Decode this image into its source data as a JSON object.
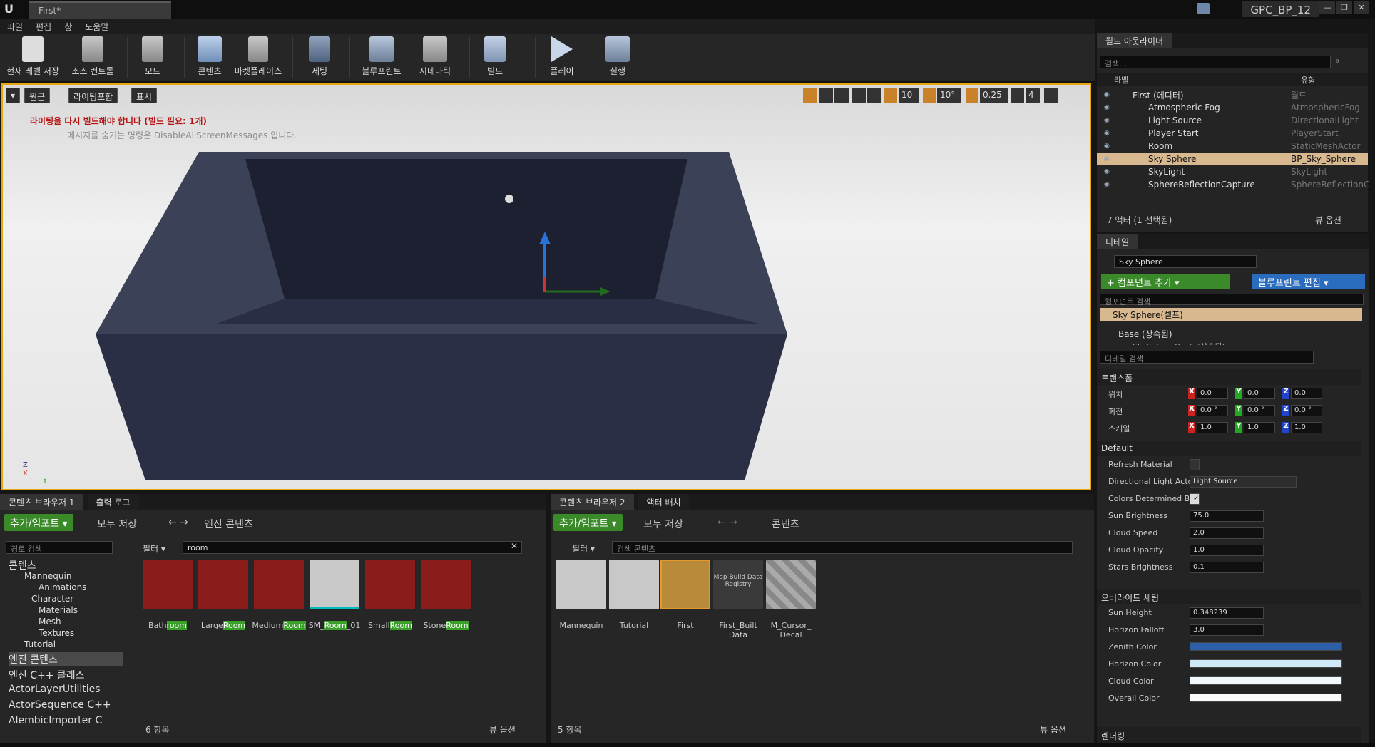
{
  "window": {
    "tab_title": "First*",
    "project": "GPC_BP_12"
  },
  "menu": [
    "파일",
    "편집",
    "창",
    "도움말"
  ],
  "toolbar": [
    {
      "label": "현재 레벨 저장",
      "icon": "save-icon"
    },
    {
      "label": "소스 컨트롤",
      "icon": "source-control-icon"
    },
    {
      "label": "모드",
      "icon": "modes-icon"
    },
    {
      "label": "콘텐츠",
      "icon": "content-icon"
    },
    {
      "label": "마켓플레이스",
      "icon": "marketplace-icon"
    },
    {
      "label": "세팅",
      "icon": "settings-icon"
    },
    {
      "label": "블루프린트",
      "icon": "blueprint-icon"
    },
    {
      "label": "시네마틱",
      "icon": "cinematics-icon"
    },
    {
      "label": "빌드",
      "icon": "build-icon"
    },
    {
      "label": "플레이",
      "icon": "play-icon"
    },
    {
      "label": "실행",
      "icon": "launch-icon"
    }
  ],
  "viewport": {
    "buttons": {
      "perspective": "원근",
      "lighting": "라이팅포함",
      "show": "표시"
    },
    "snap": {
      "grid": "10",
      "rotation": "10°",
      "scale": "0.25",
      "camera_speed": "4"
    },
    "warning": "라이팅을 다시 빌드해야 합니다 (빌드 필요: 1개)",
    "hint": "메시지를 숨기는 명령은 DisableAllScreenMessages 입니다."
  },
  "outliner": {
    "tab": "월드 아웃라이너",
    "search_placeholder": "검색...",
    "col_label": "라벨",
    "col_type": "유형",
    "rows": [
      {
        "name": "First (에디터)",
        "type": "월드"
      },
      {
        "name": "Atmospheric Fog",
        "type": "AtmosphericFog"
      },
      {
        "name": "Light Source",
        "type": "DirectionalLight"
      },
      {
        "name": "Player Start",
        "type": "PlayerStart"
      },
      {
        "name": "Room",
        "type": "StaticMeshActor"
      },
      {
        "name": "Sky Sphere",
        "type": "BP_Sky_Sphere"
      },
      {
        "name": "SkyLight",
        "type": "SkyLight"
      },
      {
        "name": "SphereReflectionCapture",
        "type": "SphereReflectionC"
      }
    ],
    "footer": "7 액터 (1 선택됨)",
    "view_options": "뷰 옵션"
  },
  "details": {
    "tab": "디테일",
    "name": "Sky Sphere",
    "add_component": "+ 컴포넌트 추가 ▾",
    "edit_blueprint": "블루프린트 편집 ▾",
    "component_search": "컴포넌트 검색",
    "self_component": "Sky Sphere(셀프)",
    "base_component": "Base (상속됨)",
    "sub_component": "SkySphereMesh (상속됨)",
    "detail_search": "디테일 검색",
    "transform": {
      "section": "트랜스폼",
      "location_label": "위치",
      "rotation_label": "회전",
      "scale_label": "스케일",
      "location": [
        "0.0",
        "0.0",
        "0.0"
      ],
      "rotation": [
        "0.0 °",
        "0.0 °",
        "0.0 °"
      ],
      "scale": [
        "1.0",
        "1.0",
        "1.0"
      ]
    },
    "default_section": "Default",
    "props": {
      "refresh_material": "Refresh Material",
      "directional_light_actor": "Directional Light Actor",
      "directional_light_value": "Light Source",
      "colors_determined_by": "Colors Determined By",
      "sun_brightness": "Sun Brightness",
      "sun_brightness_value": "75.0",
      "cloud_speed": "Cloud Speed",
      "cloud_speed_value": "2.0",
      "cloud_opacity": "Cloud Opacity",
      "cloud_opacity_value": "1.0",
      "stars_brightness": "Stars Brightness",
      "stars_brightness_value": "0.1"
    },
    "override_section": "오버라이드 세팅",
    "override": {
      "sun_height": "Sun Height",
      "sun_height_value": "0.348239",
      "horizon_falloff": "Horizon Falloff",
      "horizon_falloff_value": "3.0",
      "zenith_color": "Zenith Color",
      "horizon_color": "Horizon Color",
      "cloud_color": "Cloud Color",
      "overall_color": "Overall Color"
    },
    "rendering_section": "렌더링",
    "colors": {
      "zenith": "#2d5fa8",
      "horizon": "#cfe8f8",
      "cloud": "#f2f8fc",
      "overall": "#fafafa"
    }
  },
  "cb1": {
    "tab1": "콘텐츠 브라우저 1",
    "tab2": "출력 로그",
    "add_import": "추가/임포트 ▾",
    "save_all": "모두 저장",
    "path": "엔진 콘텐츠",
    "path_search": "경로 검색",
    "filter": "필터 ▾",
    "search_value": "room",
    "tree": [
      "콘텐츠",
      "Mannequin",
      "Animations",
      "Character",
      "Materials",
      "Mesh",
      "Textures",
      "Tutorial",
      "엔진 콘텐츠",
      "엔진 C++ 클래스",
      "ActorLayerUtilities",
      "ActorSequence C++",
      "AlembicImporter C"
    ],
    "assets": [
      [
        "Bath",
        "room",
        ""
      ],
      [
        "Large",
        "Room",
        ""
      ],
      [
        "Medium",
        "Room",
        ""
      ],
      [
        "SM_",
        "Room",
        "_01"
      ],
      [
        "Small",
        "Room",
        ""
      ],
      [
        "Stone",
        "Room",
        ""
      ]
    ],
    "count": "6 항목",
    "view_options": "뷰 옵션"
  },
  "cb2": {
    "tab1": "콘텐츠 브라우저 2",
    "tab2": "액터 배치",
    "add_import": "추가/임포트 ▾",
    "save_all": "모두 저장",
    "path": "콘텐츠",
    "filter": "필터 ▾",
    "search_placeholder": "검색 콘텐츠",
    "assets": [
      "Mannequin",
      "Tutorial",
      "First",
      "First_Built Data",
      "M_Cursor_ Decal"
    ],
    "map_build_label": "Map Build Data Registry",
    "count": "5 항목",
    "view_options": "뷰 옵션"
  }
}
